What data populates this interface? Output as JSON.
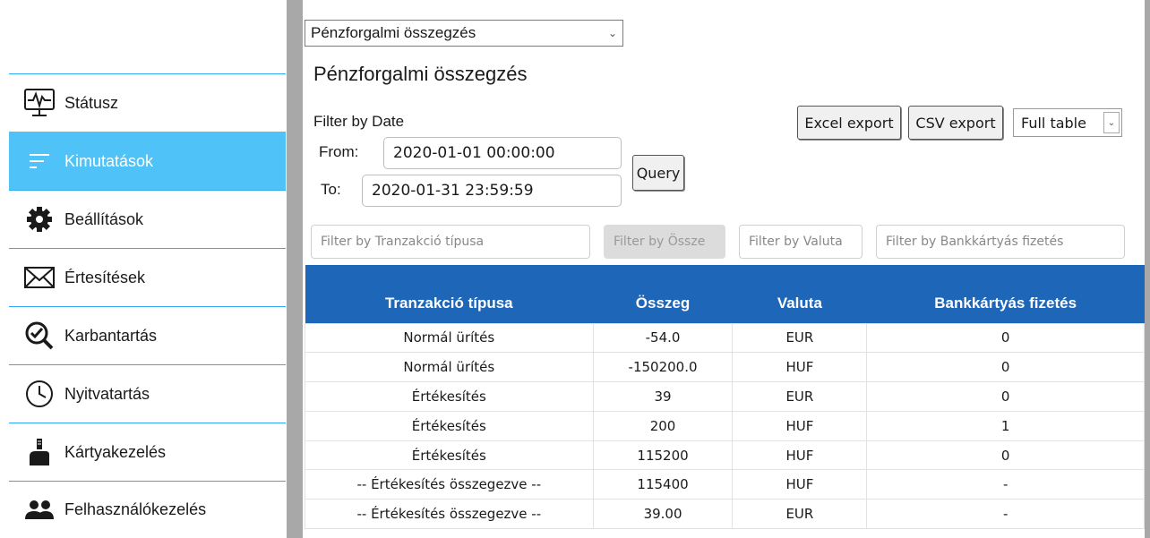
{
  "sidebar": {
    "items": [
      {
        "label": "Státusz",
        "icon": "monitor-pulse-icon",
        "active": false
      },
      {
        "label": "Kimutatások",
        "icon": "lines-icon",
        "active": true
      },
      {
        "label": "Beállítások",
        "icon": "gear-icon",
        "active": false
      },
      {
        "label": "Értesítések",
        "icon": "envelope-icon",
        "active": false
      },
      {
        "label": "Karbantartás",
        "icon": "magnifier-check-icon",
        "active": false
      },
      {
        "label": "Nyitvatartás",
        "icon": "clock-icon",
        "active": false
      },
      {
        "label": "Kártyakezelés",
        "icon": "card-hand-icon",
        "active": false
      },
      {
        "label": "Felhasználókezelés",
        "icon": "users-icon",
        "active": false
      }
    ],
    "accent": "#4fc3f7"
  },
  "report_select": {
    "value": "Pénzforgalmi összegzés"
  },
  "page_title": "Pénzforgalmi összegzés",
  "date_filter": {
    "label": "Filter by Date",
    "from_label": "From:",
    "from_value": "2020-01-01 00:00:00",
    "to_label": "To:",
    "to_value": "2020-01-31 23:59:59",
    "query_label": "Query"
  },
  "toolbar": {
    "excel_label": "Excel export",
    "csv_label": "CSV export",
    "view_select": "Full table"
  },
  "column_filters": {
    "type": "Filter by Tranzakció típusa",
    "amount": "Filter by Össze",
    "currency": "Filter by Valuta",
    "card": "Filter by Bankkártyás fizetés"
  },
  "table": {
    "header_color": "#1e66b8",
    "columns": [
      "Tranzakció típusa",
      "Összeg",
      "Valuta",
      "Bankkártyás fizetés"
    ],
    "rows": [
      [
        "Normál ürítés",
        "-54.0",
        "EUR",
        "0"
      ],
      [
        "Normál ürítés",
        "-150200.0",
        "HUF",
        "0"
      ],
      [
        "Értékesítés",
        "39",
        "EUR",
        "0"
      ],
      [
        "Értékesítés",
        "200",
        "HUF",
        "1"
      ],
      [
        "Értékesítés",
        "115200",
        "HUF",
        "0"
      ],
      [
        "-- Értékesítés összegezve --",
        "115400",
        "HUF",
        "-"
      ],
      [
        "-- Értékesítés összegezve --",
        "39.00",
        "EUR",
        "-"
      ]
    ]
  }
}
